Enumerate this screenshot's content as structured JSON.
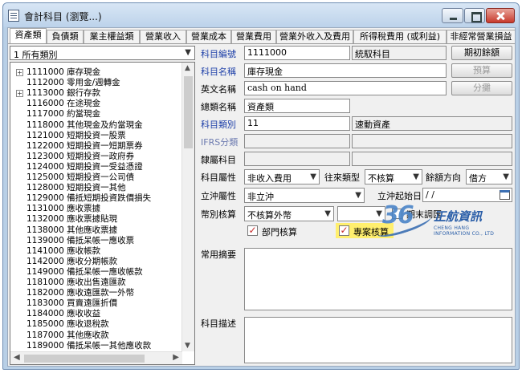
{
  "window": {
    "title": "會計科目 (瀏覽...)"
  },
  "tabs": [
    "資產類",
    "負債類",
    "業主權益類",
    "營業收入",
    "營業成本",
    "營業費用",
    "營業外收入及費用",
    "所得稅費用 (或利益)",
    "非經常營業損益"
  ],
  "left": {
    "type_select": "1 所有類別",
    "tree": [
      "1111000 庫存現金",
      "1112000 零用金/週轉金",
      "1113000 銀行存款",
      "1116000 在途現金",
      "1117000 約當現金",
      "1118000 其他現金及約當現金",
      "1121000 短期投資一股票",
      "1122000 短期投資一短期票券",
      "1123000 短期投資一政府券",
      "1124000 短期投資一受益憑證",
      "1125000 短期投資一公司債",
      "1128000 短期投資一其他",
      "1129000 備抵短期投資跌價損失",
      "1131000 應收票據",
      "1132000 應收票據貼現",
      "1138000 其他應收票據",
      "1139000 備抵呆帳一應收票",
      "1141000 應收帳款",
      "1142000 應收分期帳款",
      "1149000 備抵呆帳一應收帳款",
      "1181000 應收出售遠匯款",
      "1182000 應收遠匯款一外幣",
      "1183000 買賣遠匯折價",
      "1184000 應收收益",
      "1185000 應收退稅款",
      "1187000 其他應收款",
      "1189000 備抵呆帳一其他應收款"
    ],
    "expandable": [
      true,
      false,
      true,
      false,
      false,
      false,
      false,
      false,
      false,
      false,
      false,
      false,
      false,
      false,
      false,
      false,
      false,
      false,
      false,
      false,
      false,
      false,
      false,
      false,
      false,
      false,
      false
    ]
  },
  "form": {
    "code_label": "科目編號",
    "code_value": "1111000",
    "stat_label": "統馭科目",
    "name_label": "科目名稱",
    "name_value": "庫存現金",
    "en_label": "英文名稱",
    "en_value": "cash on hand",
    "class_label": "總類名稱",
    "class_value": "資產類",
    "cat_label": "科目類別",
    "cat_value": "11",
    "cat_name": "速動資產",
    "ifrs_label": "IFRS分類",
    "parent_label": "隸屬科目",
    "attr_label": "科目屬性",
    "attr_value": "非收入費用",
    "trans_label": "往來類型",
    "trans_value": "不核算",
    "bal_label": "餘額方向",
    "bal_value": "借方",
    "offset_label": "立沖屬性",
    "offset_value": "非立沖",
    "offset_date_label": "立沖起始日",
    "offset_date_value": "/ /",
    "currency_label": "幣別核算",
    "currency_value": "不核算外幣",
    "period_adjust_label": "期末調匯",
    "dept_label": "部門核算",
    "project_label": "專案核算",
    "summary_label": "常用摘要",
    "desc_label": "科目描述"
  },
  "buttons": {
    "opening": "期初餘額",
    "budget": "預算",
    "share": "分攤"
  },
  "watermark": {
    "brand_digits": "36",
    "brand_name": "正航資訊",
    "brand_en": "CHENG HANG INFORMATION CO., LTD"
  },
  "colors": {
    "titlebar": "#c9dbef",
    "required_label": "#1d3fa8",
    "highlight": "#ffef6e",
    "check": "#c62828"
  }
}
